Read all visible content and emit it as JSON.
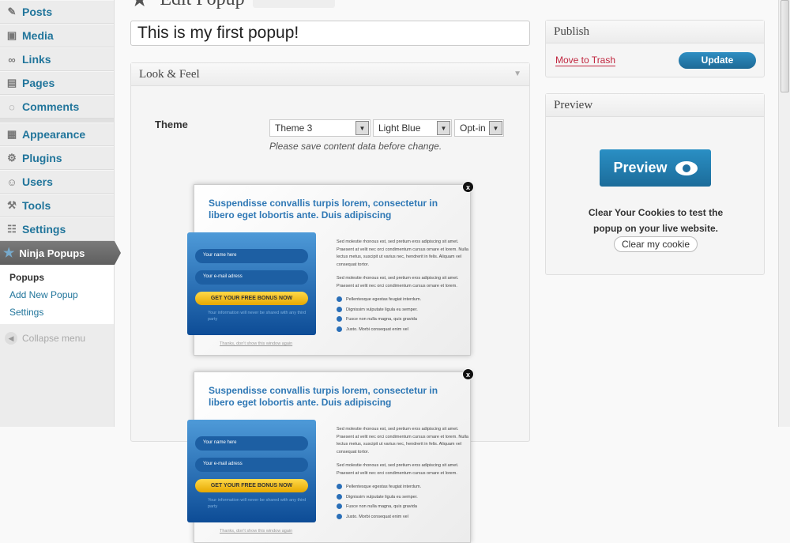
{
  "sidebar": {
    "items": [
      {
        "label": "Posts",
        "icon": "pin-icon"
      },
      {
        "label": "Media",
        "icon": "media-icon"
      },
      {
        "label": "Links",
        "icon": "link-icon"
      },
      {
        "label": "Pages",
        "icon": "pages-icon"
      },
      {
        "label": "Comments",
        "icon": "comment-icon"
      },
      {
        "label": "Appearance",
        "icon": "appearance-icon"
      },
      {
        "label": "Plugins",
        "icon": "plugin-icon"
      },
      {
        "label": "Users",
        "icon": "users-icon"
      },
      {
        "label": "Tools",
        "icon": "tools-icon"
      },
      {
        "label": "Settings",
        "icon": "settings-icon"
      }
    ],
    "active": "Ninja Popups",
    "submenu": [
      "Popups",
      "Add New Popup",
      "Settings"
    ],
    "collapse": "Collapse menu"
  },
  "page": {
    "title": "Edit Popup",
    "popup_title": "This is my first popup!"
  },
  "look": {
    "heading": "Look & Feel",
    "theme_label": "Theme",
    "theme": "Theme 3",
    "color": "Light Blue",
    "type": "Opt-in",
    "note": "Please save content data before change."
  },
  "popup_preview": {
    "headline": "Suspendisse convallis turpis lorem, consectetur in libero eget lobortis ante. Duis adipiscing",
    "name_ph": "Your name here",
    "email_ph": "Your e-mail adress",
    "cta": "GET YOUR FREE BONUS NOW",
    "privacy": "Your information will never be shared with any third party",
    "p1": "Sed molestie rhonous est, sed pretium eros adipiscing sit amet. Praesent at velit nec orci condimentum cursus ornare et lorem. Nulla lectus metus, suscipit ut varius nec, hendrerit in felis. Aliquam vel consequat tortor.",
    "p2": "Sed molestie rhonous est, sed pretium eros adipiscing sit amet. Praesent at velit nec orci condimentum cursus ornare et lorem.",
    "bullets": [
      "Pellentesque egestas feugiat interdum.",
      "Dignissim vulputate ligula eu semper.",
      "Fusce non nulla magna, quis gravida",
      "Justo. Morbi consequat enim vel"
    ],
    "thanks": "Thanks, don't show this window again"
  },
  "publish": {
    "heading": "Publish",
    "trash": "Move to Trash",
    "update": "Update"
  },
  "preview": {
    "heading": "Preview",
    "button": "Preview",
    "text": "Clear Your Cookies to test the popup on your live website.",
    "clear": "Clear my cookie"
  }
}
